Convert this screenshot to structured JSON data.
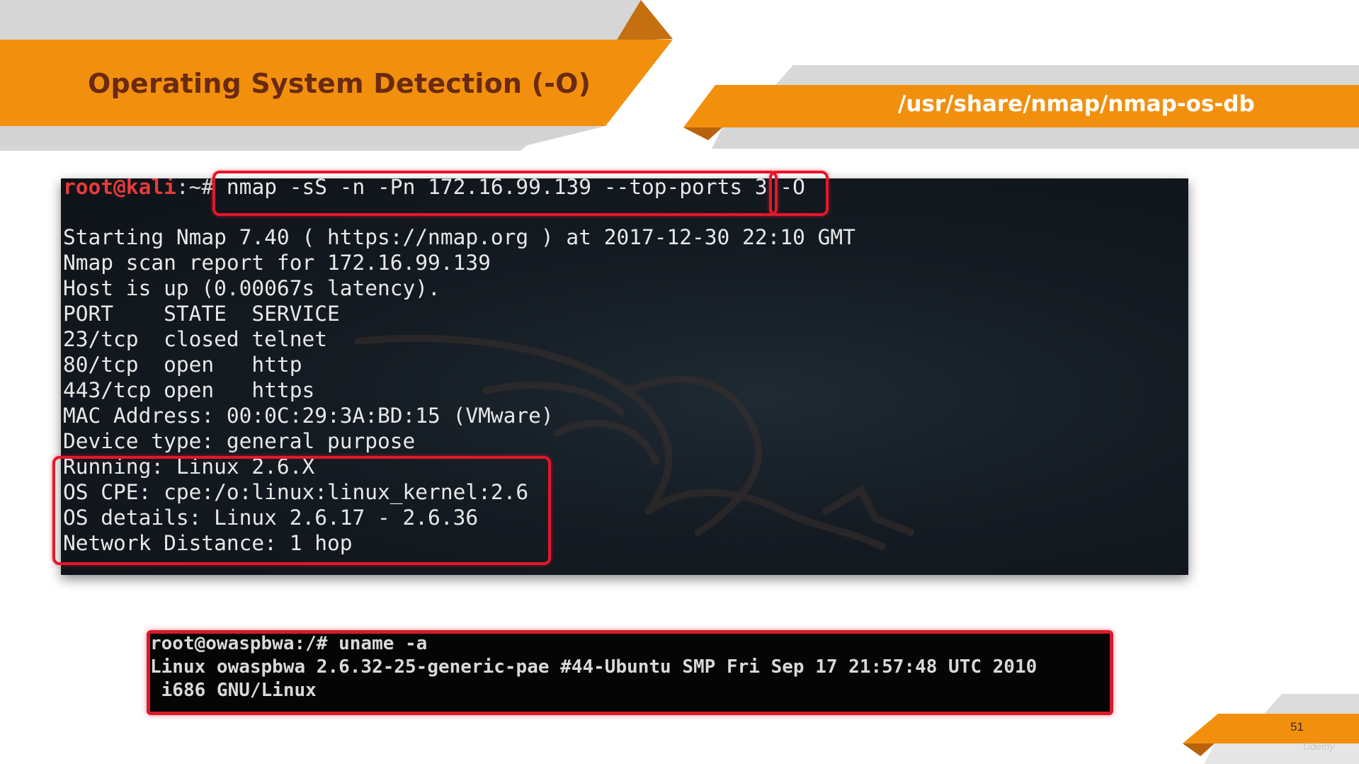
{
  "slide": {
    "title": "Operating System Detection (-O)",
    "path": "/usr/share/nmap/nmap-os-db",
    "page_number": "51",
    "brand": "Udemy"
  },
  "colors": {
    "orange": "#f2900e",
    "dark_orange": "#d27a10",
    "gray": "#d0d0d0",
    "title_text": "#6a2a12",
    "highlight_red": "#e3172b",
    "prompt_red": "#e83a3a"
  },
  "terminal": {
    "prompt_user": "root@kali",
    "prompt_sep": ":~#",
    "command": " nmap -sS -n -Pn 172.16.99.139 --top-ports 3 -O",
    "lines": [
      "Starting Nmap 7.40 ( https://nmap.org ) at 2017-12-30 22:10 GMT",
      "Nmap scan report for 172.16.99.139",
      "Host is up (0.00067s latency).",
      "PORT    STATE  SERVICE",
      "23/tcp  closed telnet",
      "80/tcp  open   http",
      "443/tcp open   https",
      "MAC Address: 00:0C:29:3A:BD:15 (VMware)",
      "Device type: general purpose",
      "Running: Linux 2.6.X",
      "OS CPE: cpe:/o:linux:linux_kernel:2.6",
      "OS details: Linux 2.6.17 - 2.6.36",
      "Network Distance: 1 hop"
    ]
  },
  "terminal2": {
    "lines": [
      "root@owaspbwa:/# uname -a",
      "Linux owaspbwa 2.6.32-25-generic-pae #44-Ubuntu SMP Fri Sep 17 21:57:48 UTC 2010",
      " i686 GNU/Linux"
    ]
  }
}
